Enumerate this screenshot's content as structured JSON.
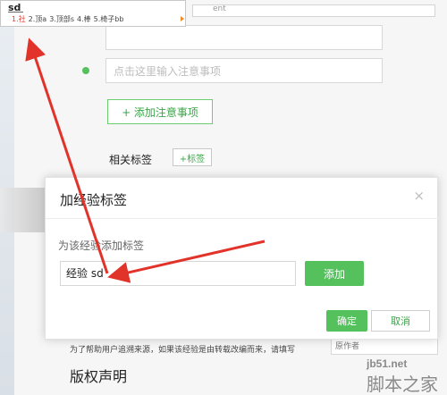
{
  "ime": {
    "composition": "sd",
    "candidates": [
      "1.社",
      "2.顶a",
      "3.顶部s",
      "4.棒",
      "5.椅子bb"
    ],
    "input_bar_hint": "ent"
  },
  "background": {
    "notice_placeholder": "点击这里输入注意事项",
    "add_notice_button": "+ 添加注意事项",
    "related_tags_label": "相关标签",
    "tag_add_button": "+标签",
    "footer_note": "为了帮助用户追溯来源，如果该经验是由转载改编而来，请填写",
    "footer_field_text": "原作者",
    "copyright_title": "版权声明"
  },
  "dialog": {
    "title": "加经验标签",
    "close_icon": "×",
    "prompt": "为该经验添加标签",
    "input_value": "经验 sd",
    "add_button": "添加",
    "confirm_button": "确定",
    "cancel_button": "取消"
  },
  "watermark": {
    "domain": "jb51.net",
    "text": "脚本之家"
  },
  "colors": {
    "green": "#54c15d",
    "arrow_red": "#e2332b"
  }
}
